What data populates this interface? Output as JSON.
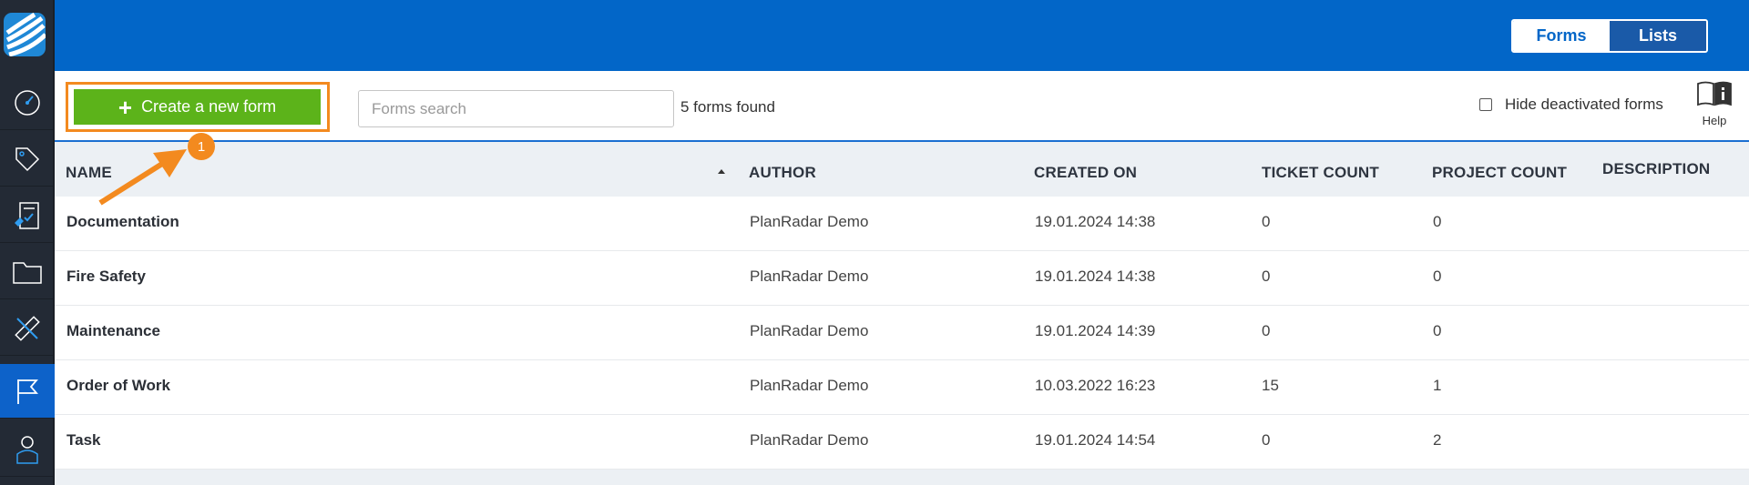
{
  "sidebar": {
    "items": [
      {
        "name": "dashboard-icon"
      },
      {
        "name": "tag-icon"
      },
      {
        "name": "checklist-icon"
      },
      {
        "name": "folder-icon"
      },
      {
        "name": "ruler-icon"
      },
      {
        "name": "flag-icon",
        "active": true
      },
      {
        "name": "user-icon"
      }
    ]
  },
  "topbar": {
    "forms_label": "Forms",
    "lists_label": "Lists",
    "bell_icon": "bell-icon"
  },
  "toolbar": {
    "create_label": "Create a new form",
    "search_placeholder": "Forms search",
    "search_value": "",
    "found_text": "5 forms found",
    "hide_label": "Hide deactivated forms",
    "hide_checked": false,
    "help_label": "Help"
  },
  "table": {
    "columns": [
      "NAME",
      "AUTHOR",
      "CREATED ON",
      "TICKET COUNT",
      "PROJECT COUNT",
      "DESCRIPTION"
    ],
    "rows": [
      {
        "name": "Documentation",
        "author": "PlanRadar Demo",
        "created": "19.01.2024 14:38",
        "tickets": "0",
        "projects": "0",
        "description": ""
      },
      {
        "name": "Fire Safety",
        "author": "PlanRadar Demo",
        "created": "19.01.2024 14:38",
        "tickets": "0",
        "projects": "0",
        "description": ""
      },
      {
        "name": "Maintenance",
        "author": "PlanRadar Demo",
        "created": "19.01.2024 14:39",
        "tickets": "0",
        "projects": "0",
        "description": ""
      },
      {
        "name": "Order of Work",
        "author": "PlanRadar Demo",
        "created": "10.03.2022 16:23",
        "tickets": "15",
        "projects": "1",
        "description": ""
      },
      {
        "name": "Task",
        "author": "PlanRadar Demo",
        "created": "19.01.2024 14:54",
        "tickets": "0",
        "projects": "2",
        "description": ""
      }
    ]
  },
  "annotation": {
    "badge_number": "1",
    "color": "#f38a1f"
  },
  "colors": {
    "brand_blue": "#0266c8",
    "create_green": "#5cb31a",
    "sidebar_dark": "#232a35"
  }
}
